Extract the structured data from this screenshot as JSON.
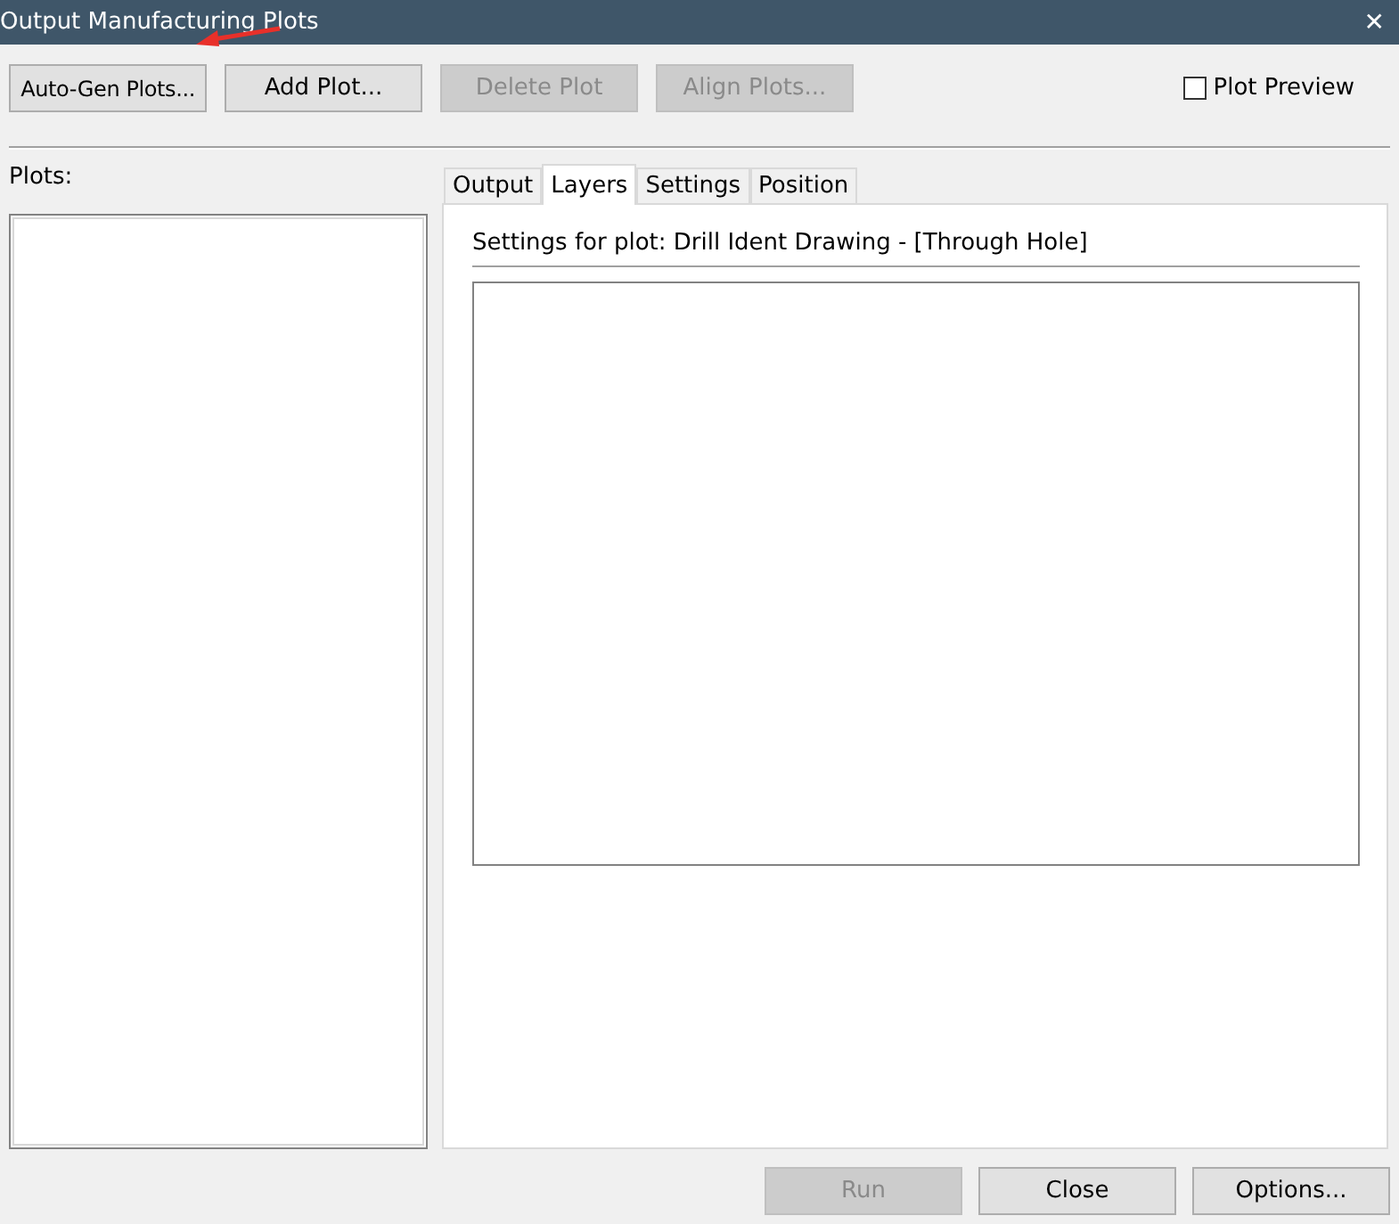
{
  "window": {
    "title": "Output Manufacturing Plots",
    "close": "✕"
  },
  "toolbar": {
    "buttons": [
      {
        "label": "Auto-Gen Plots...",
        "disabled": false
      },
      {
        "label": "Add Plot...",
        "disabled": false
      },
      {
        "label": "Delete Plot",
        "disabled": true
      },
      {
        "label": "Align Plots...",
        "disabled": true
      }
    ],
    "preview": {
      "label": "Plot Preview",
      "checked": false
    }
  },
  "plots": {
    "label": "Plots:"
  },
  "tabs": [
    {
      "label": "Output",
      "selected": false
    },
    {
      "label": "Layers",
      "selected": true
    },
    {
      "label": "Settings",
      "selected": false
    },
    {
      "label": "Position",
      "selected": false
    }
  ],
  "panel": {
    "heading": "Settings for plot: Drill Ident Drawing - [Through Hole]"
  },
  "footer": {
    "buttons": [
      {
        "label": "Run",
        "disabled": true
      },
      {
        "label": "Close",
        "disabled": false
      },
      {
        "label": "Options...",
        "disabled": false
      }
    ]
  }
}
